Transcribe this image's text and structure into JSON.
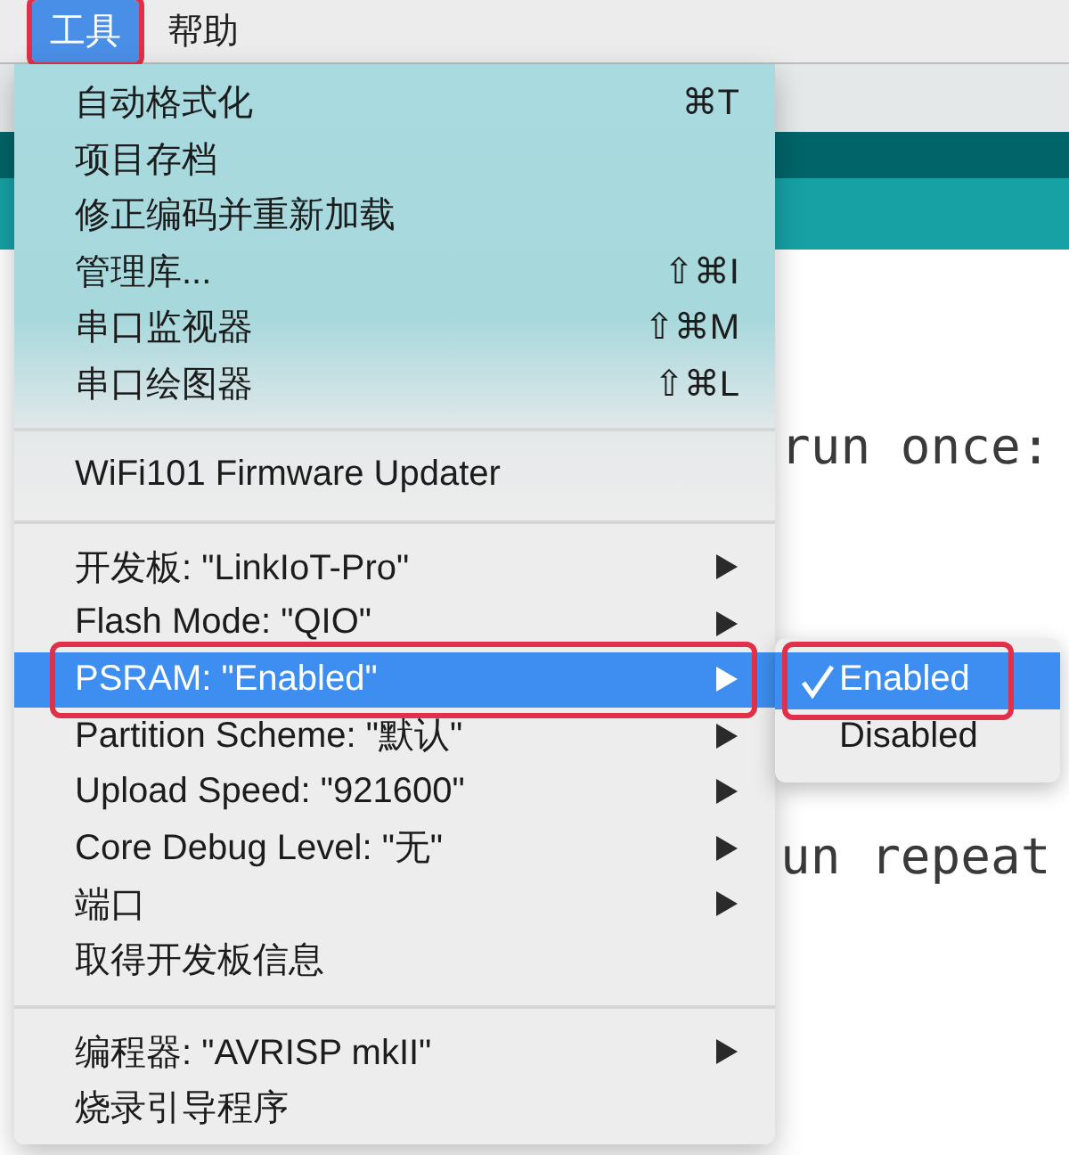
{
  "menubar": {
    "items": [
      {
        "label": "工具",
        "selected": true,
        "highlighted": true
      },
      {
        "label": "帮助",
        "selected": false,
        "highlighted": false
      }
    ]
  },
  "editor": {
    "lines": [
      {
        "right": "run once:"
      },
      {
        "right": "un repeat"
      }
    ]
  },
  "menu": {
    "items": [
      {
        "kind": "item",
        "label": "自动格式化",
        "shortcut": "⌘T",
        "submenu": false,
        "selected": false,
        "highlighted": false
      },
      {
        "kind": "item",
        "label": "项目存档",
        "submenu": false,
        "selected": false,
        "highlighted": false
      },
      {
        "kind": "item",
        "label": "修正编码并重新加载",
        "submenu": false,
        "selected": false,
        "highlighted": false
      },
      {
        "kind": "item",
        "label": "管理库...",
        "shortcut": "⇧⌘I",
        "submenu": false,
        "selected": false,
        "highlighted": false
      },
      {
        "kind": "item",
        "label": "串口监视器",
        "shortcut": "⇧⌘M",
        "submenu": false,
        "selected": false,
        "highlighted": false
      },
      {
        "kind": "item",
        "label": "串口绘图器",
        "shortcut": "⇧⌘L",
        "submenu": false,
        "selected": false,
        "highlighted": false
      },
      {
        "kind": "separator"
      },
      {
        "kind": "item",
        "label": "WiFi101 Firmware Updater",
        "submenu": false,
        "selected": false,
        "highlighted": false
      },
      {
        "kind": "separator"
      },
      {
        "kind": "item",
        "label": "开发板: \"LinkIoT-Pro\"",
        "submenu": true,
        "selected": false,
        "highlighted": false
      },
      {
        "kind": "item",
        "label": "Flash Mode: \"QIO\"",
        "submenu": true,
        "selected": false,
        "highlighted": false
      },
      {
        "kind": "item",
        "label": "PSRAM: \"Enabled\"",
        "submenu": true,
        "selected": true,
        "highlighted": true
      },
      {
        "kind": "item",
        "label": "Partition Scheme: \"默认\"",
        "submenu": true,
        "selected": false,
        "highlighted": false
      },
      {
        "kind": "item",
        "label": "Upload Speed: \"921600\"",
        "submenu": true,
        "selected": false,
        "highlighted": false
      },
      {
        "kind": "item",
        "label": "Core Debug Level: \"无\"",
        "submenu": true,
        "selected": false,
        "highlighted": false
      },
      {
        "kind": "item",
        "label": "端口",
        "submenu": true,
        "selected": false,
        "highlighted": false
      },
      {
        "kind": "item",
        "label": "取得开发板信息",
        "submenu": false,
        "selected": false,
        "highlighted": false
      },
      {
        "kind": "separator"
      },
      {
        "kind": "item",
        "label": "编程器: \"AVRISP mkII\"",
        "submenu": true,
        "selected": false,
        "highlighted": false
      },
      {
        "kind": "item",
        "label": "烧录引导程序",
        "submenu": false,
        "selected": false,
        "highlighted": false
      }
    ]
  },
  "submenu": {
    "items": [
      {
        "label": "Enabled",
        "checked": true,
        "selected": true,
        "highlighted": true
      },
      {
        "label": "Disabled",
        "checked": false,
        "selected": false,
        "highlighted": false
      }
    ]
  }
}
